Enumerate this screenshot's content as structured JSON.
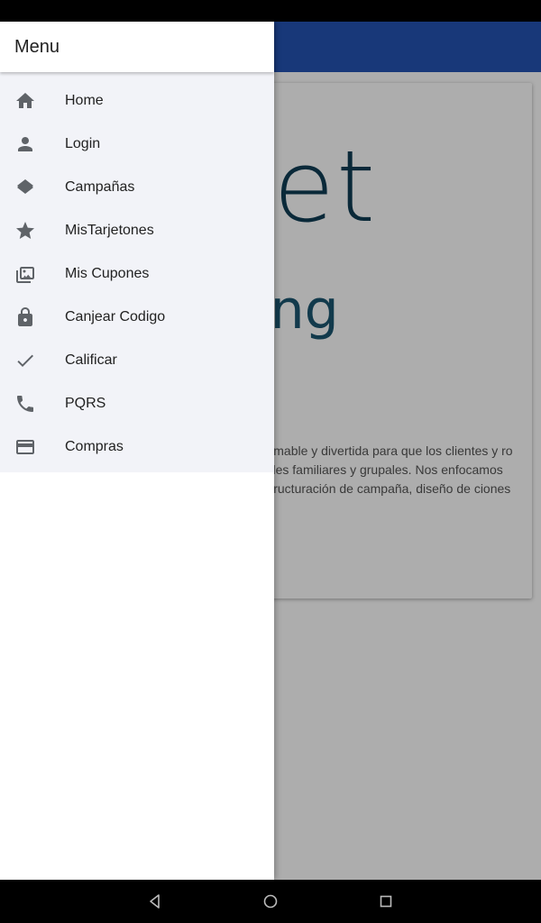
{
  "drawer": {
    "title": "Menu",
    "items": [
      {
        "label": "Home",
        "icon": "home-icon"
      },
      {
        "label": "Login",
        "icon": "person-icon"
      },
      {
        "label": "Campañas",
        "icon": "layers-icon"
      },
      {
        "label": "MisTarjetones",
        "icon": "star-icon"
      },
      {
        "label": "Mis Cupones",
        "icon": "photo-library-icon"
      },
      {
        "label": "Canjear Codigo",
        "icon": "lock-icon"
      },
      {
        "label": "Calificar",
        "icon": "check-icon"
      },
      {
        "label": "PQRS",
        "icon": "phone-icon"
      },
      {
        "label": "Compras",
        "icon": "credit-card-icon"
      }
    ]
  },
  "main": {
    "logo": {
      "line1": "rget",
      "line2": "marketing"
    },
    "description": "en el modelo “CUPON” que globalmente mable y divertida para que los clientes y ro le sean trasladados descuentos de alto ales familiares y grupales. Nos enfocamos objetivo. Estrategias creativas para s, estructuración de campaña, diseño de ciones online, medición y seguimiento de"
  },
  "colors": {
    "app_bar": "#2453b3",
    "drawer_list_bg": "#f2f3f8",
    "icon": "#5f6368",
    "logo": "#0f3d55"
  },
  "nav": {
    "icons": [
      "back-icon",
      "home-circle-icon",
      "recents-icon"
    ]
  }
}
